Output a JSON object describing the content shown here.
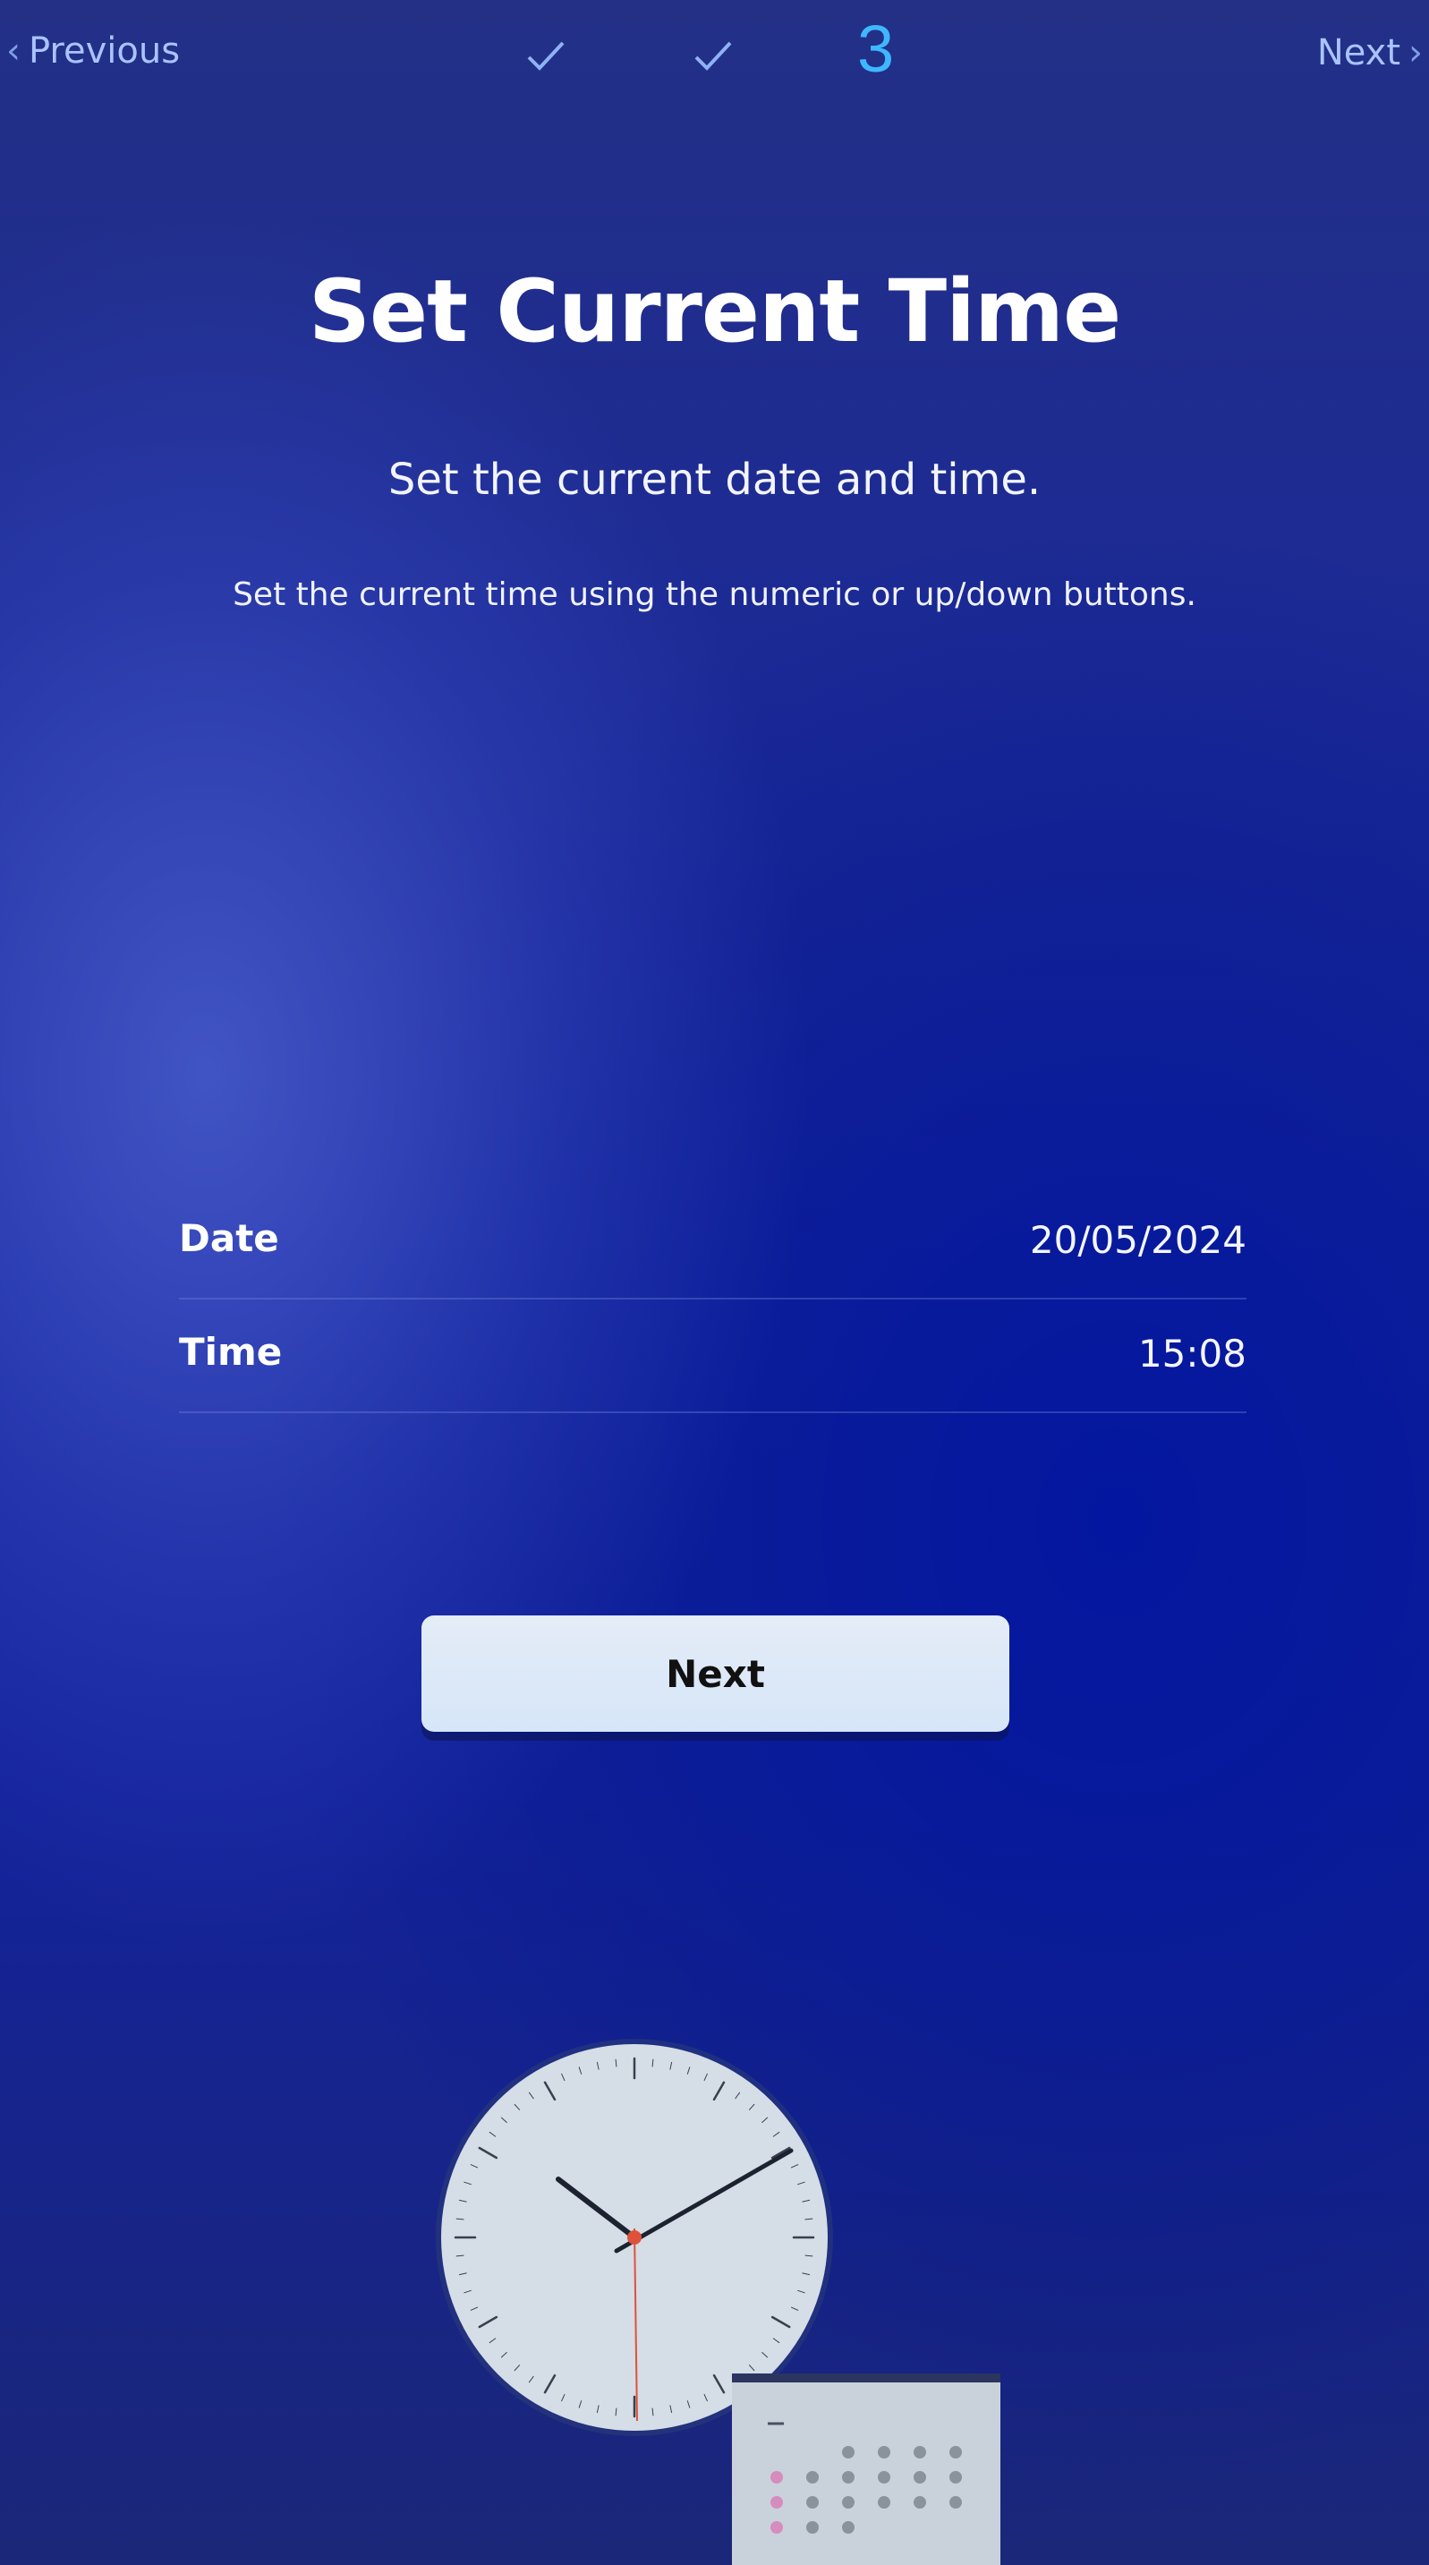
{
  "nav": {
    "previous_label": "Previous",
    "next_label": "Next",
    "current_step": "3"
  },
  "title": "Set Current Time",
  "subtitle": "Set the current date and time.",
  "hint": "Set the current time using the numeric or up/down buttons.",
  "settings": {
    "rows": [
      {
        "label": "Date",
        "value": "20/05/2024"
      },
      {
        "label": "Time",
        "value": "15:08"
      }
    ]
  },
  "next_button_label": "Next",
  "colors": {
    "accent": "#3fb7ff",
    "nav_text": "#a9c3ff",
    "button_bg": "#dfe9f7",
    "clock_second_hand": "#e0513a"
  },
  "icons": {
    "step_done": "check-icon",
    "prev": "chevron-left-icon",
    "next": "chevron-right-icon"
  }
}
